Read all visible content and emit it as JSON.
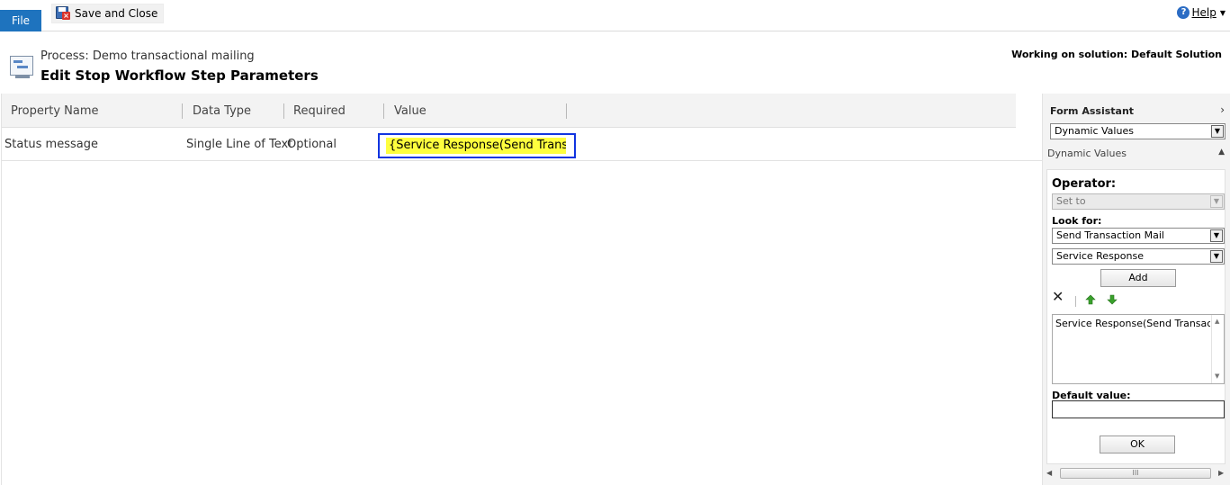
{
  "ribbon": {
    "file_tab": "File",
    "save_close_label": "Save and Close",
    "help_label": "Help"
  },
  "header": {
    "process_label": "Process: Demo transactional mailing",
    "page_title": "Edit Stop Workflow Step Parameters",
    "solution_label": "Working on solution: Default Solution"
  },
  "grid": {
    "columns": [
      "Property Name",
      "Data Type",
      "Required",
      "Value"
    ],
    "rows": [
      {
        "property_name": "Status message",
        "data_type": "Single Line of Text",
        "required": "Optional",
        "value": "{Service Response(Send Transacti"
      }
    ]
  },
  "form_assistant": {
    "title": "Form Assistant",
    "selector_value": "Dynamic Values",
    "section_label": "Dynamic Values",
    "operator_label": "Operator:",
    "operator_value": "Set to",
    "look_for_label": "Look for:",
    "look_for_entity": "Send Transaction Mail",
    "look_for_field": "Service Response",
    "add_button": "Add",
    "list_items": [
      "Service Response(Send Transactio"
    ],
    "default_value_label": "Default value:",
    "default_value": "",
    "ok_button": "OK",
    "scroll_grip": "III"
  },
  "colors": {
    "file_tab": "#1e73be",
    "value_highlight": "#fefe3e",
    "value_border": "#1134e0",
    "arrow_green": "#3aa12c"
  }
}
